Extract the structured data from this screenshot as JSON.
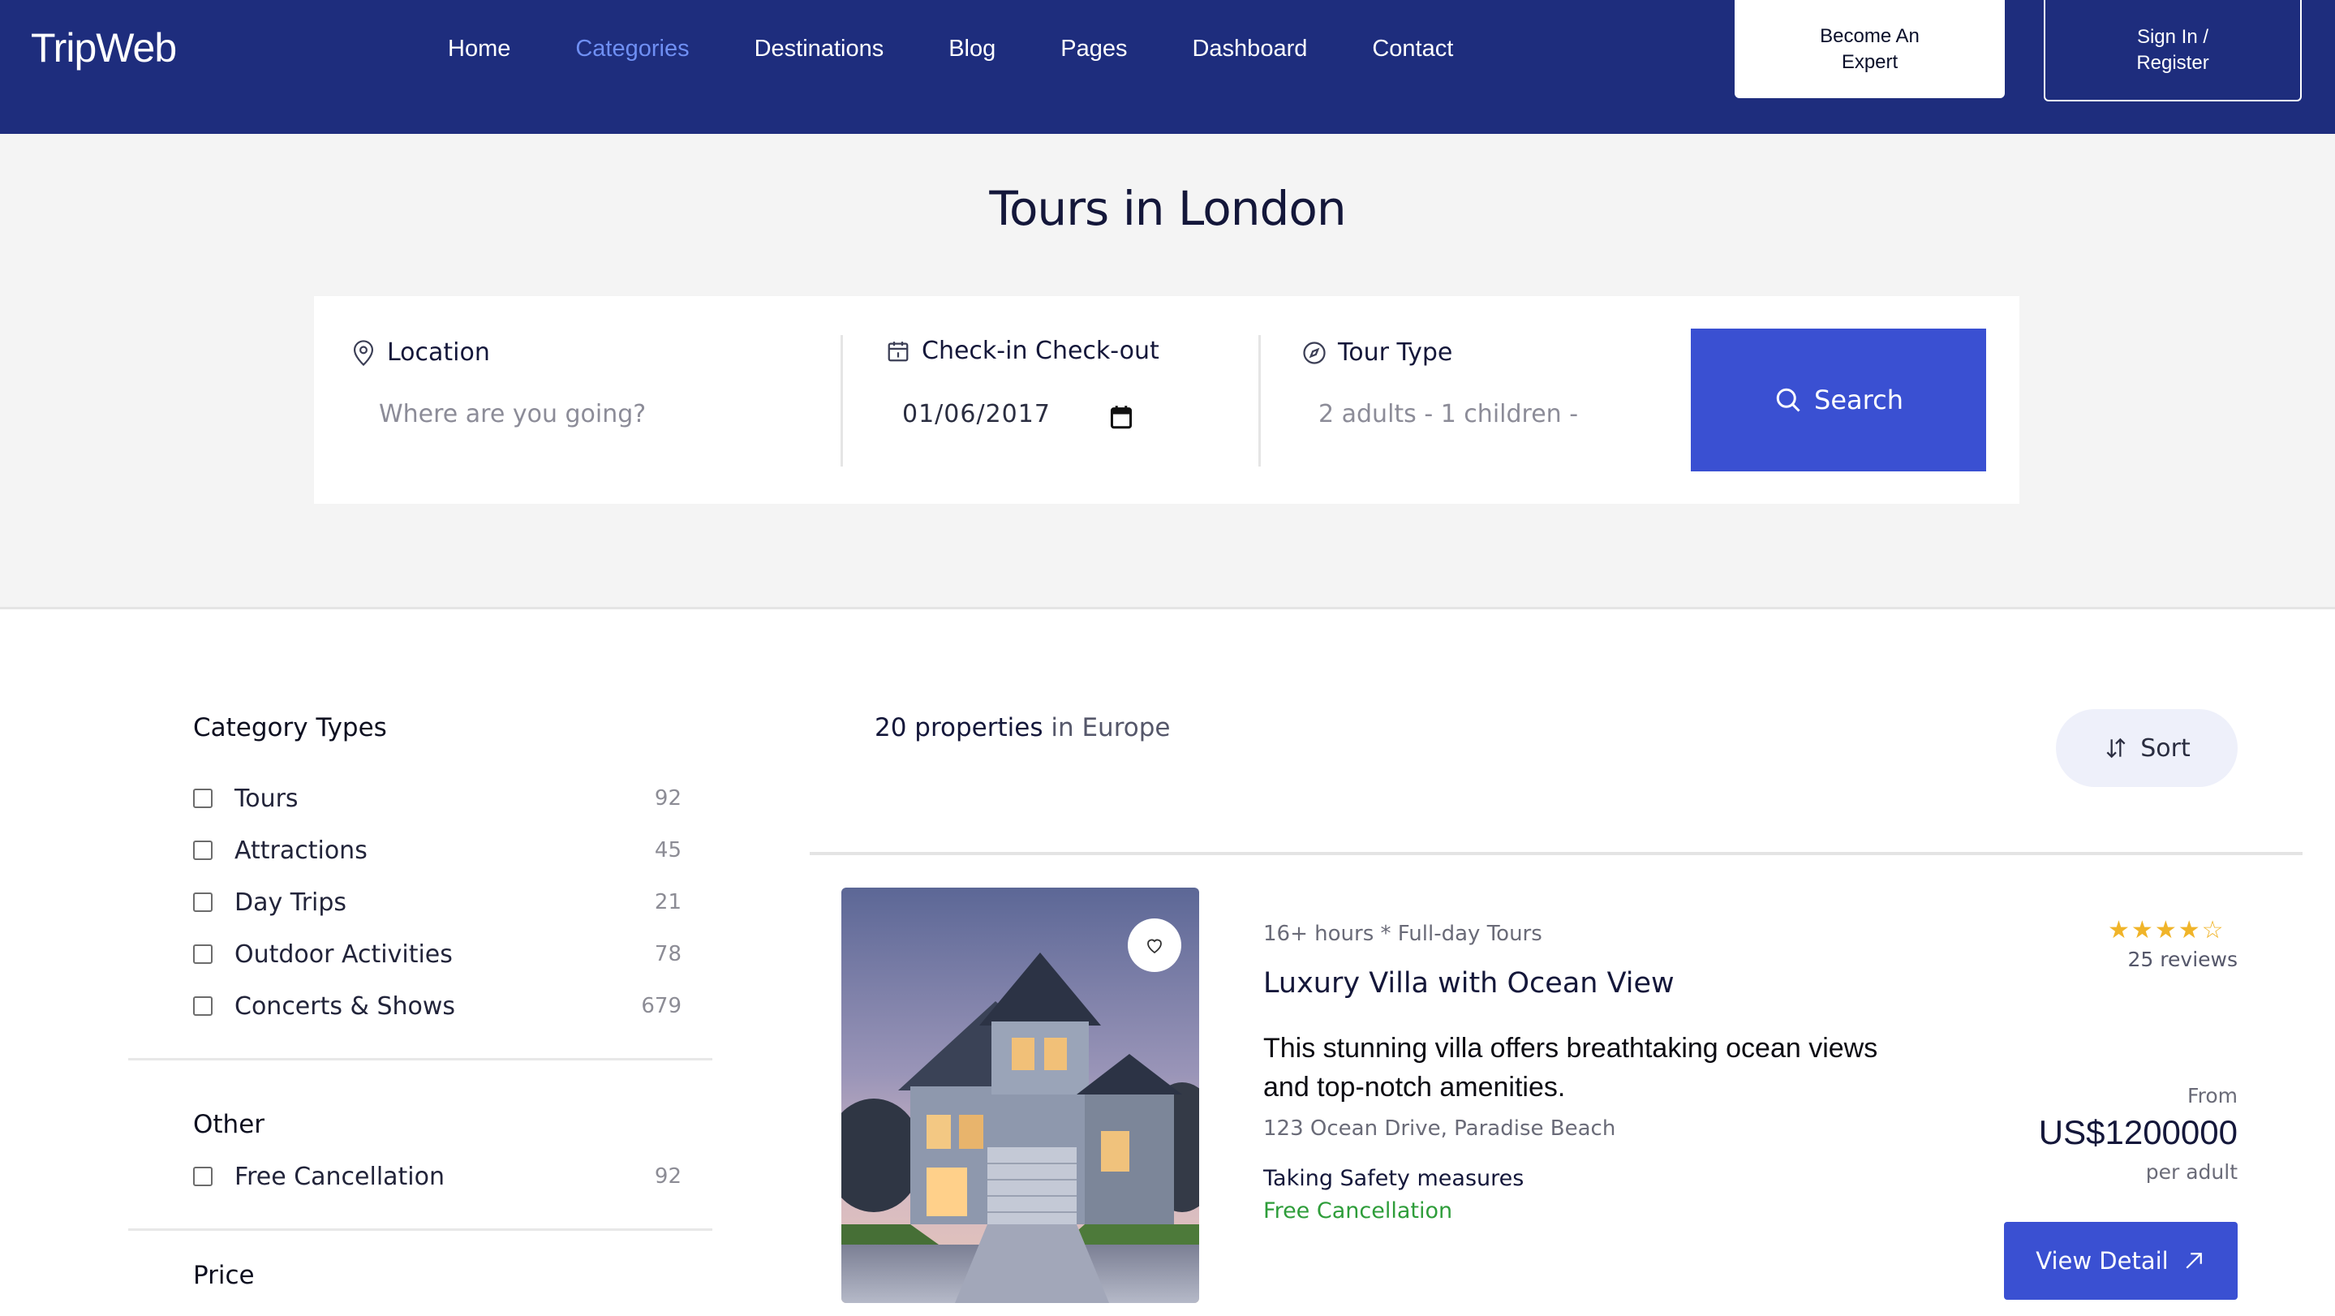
{
  "header": {
    "logo": "TripWeb",
    "nav": [
      {
        "label": "Home",
        "active": false
      },
      {
        "label": "Categories",
        "active": true
      },
      {
        "label": "Destinations",
        "active": false
      },
      {
        "label": "Blog",
        "active": false
      },
      {
        "label": "Pages",
        "active": false
      },
      {
        "label": "Dashboard",
        "active": false
      },
      {
        "label": "Contact",
        "active": false
      }
    ],
    "become_expert": "Become An Expert",
    "sign_in": "Sign In / Register"
  },
  "hero": {
    "title": "Tours in London",
    "search": {
      "location_label": "Location",
      "location_placeholder": "Where are you going?",
      "dates_label": "Check-in Check-out",
      "dates_value": "01/06/2017",
      "tour_type_label": "Tour Type",
      "tour_type_value": "2 adults - 1 children -",
      "button_label": "Search"
    }
  },
  "sidebar": {
    "category_title": "Category Types",
    "categories": [
      {
        "label": "Tours",
        "count": "92",
        "checked": false
      },
      {
        "label": "Attractions",
        "count": "45",
        "checked": false
      },
      {
        "label": "Day Trips",
        "count": "21",
        "checked": false
      },
      {
        "label": "Outdoor Activities",
        "count": "78",
        "checked": false
      },
      {
        "label": "Concerts & Shows",
        "count": "679",
        "checked": false
      }
    ],
    "other_title": "Other",
    "other": [
      {
        "label": "Free Cancellation",
        "count": "92",
        "checked": false
      }
    ],
    "price_title": "Price"
  },
  "results": {
    "count_text": "20 properties",
    "location_text": "in Europe",
    "sort_label": "Sort"
  },
  "listing": {
    "meta": "16+ hours * Full-day Tours",
    "title": "Luxury Villa with Ocean View",
    "description": "This stunning villa offers breathtaking ocean views and top-notch amenities.",
    "address": "123 Ocean Drive, Paradise Beach",
    "safety": "Taking Safety measures",
    "cancellation": "Free Cancellation",
    "rating": 4,
    "reviews": "25 reviews",
    "from": "From",
    "price": "US$1200000",
    "per": "per adult",
    "button": "View Detail"
  },
  "colors": {
    "header_bg": "#1e2d7d",
    "nav_active": "#6f8ff3",
    "primary": "#3a50d2",
    "hero_bg": "#f4f4f4",
    "star": "#f0b429",
    "success": "#2e9d3a"
  }
}
